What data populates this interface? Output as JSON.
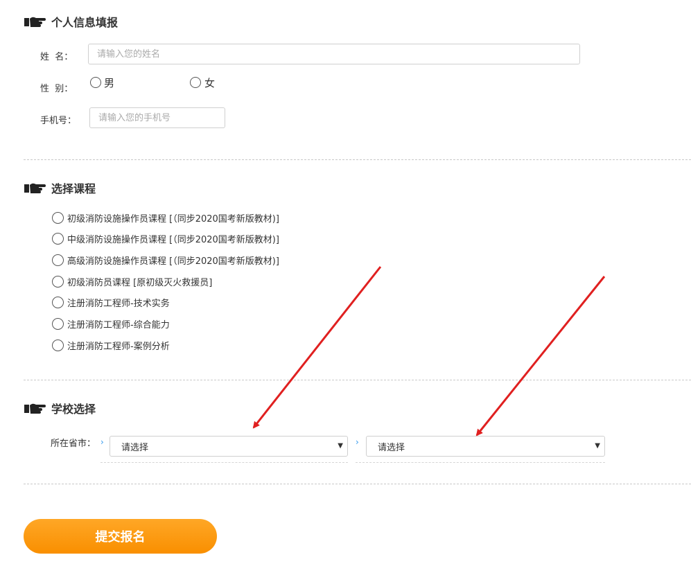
{
  "personal": {
    "title": "个人信息填报",
    "name_label": "姓  名：",
    "name_placeholder": "请输入您的姓名",
    "gender_label": "性  别：",
    "gender_options": [
      "男",
      "女"
    ],
    "phone_label": "手机号：",
    "phone_placeholder": "请输入您的手机号"
  },
  "course": {
    "title": "选择课程",
    "options": [
      "初级消防设施操作员课程 [（同步2020国考新版教材)]",
      "中级消防设施操作员课程 [（同步2020国考新版教材)]",
      "高级消防设施操作员课程 [（同步2020国考新版教材)]",
      "初级消防员课程 [原初级灭火救援员]",
      "注册消防工程师-技术实务",
      "注册消防工程师-综合能力",
      "注册消防工程师-案例分析"
    ]
  },
  "school": {
    "title": "学校选择",
    "province_label": "所在省市：",
    "select1": "请选择",
    "select2": "请选择"
  },
  "submit": {
    "label": "提交报名"
  },
  "icons": {
    "section": "pointing-hand-icon",
    "select_arrow": "dropdown-arrow-icon",
    "chevron": "chevron-right-icon"
  },
  "colors": {
    "accent_orange": "#f98f00",
    "annotation_red": "#e02020",
    "chevron_blue": "#3399ee"
  }
}
